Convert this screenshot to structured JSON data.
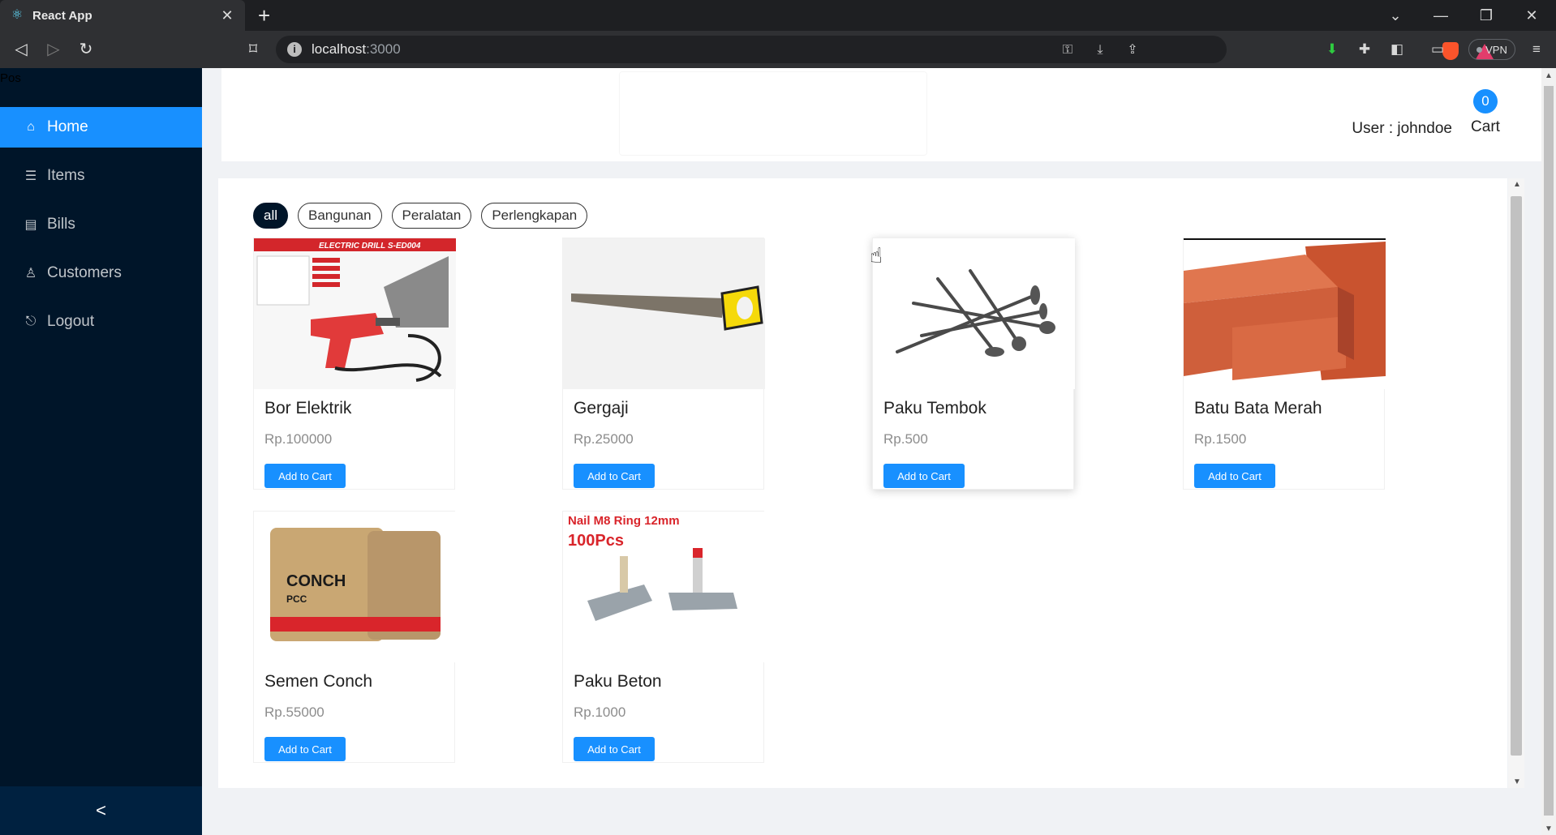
{
  "browser": {
    "tab_title": "React App",
    "tab_close": "✕",
    "new_tab": "+",
    "url_host": "localhost",
    "url_port": ":3000",
    "vpn_label": "VPN"
  },
  "sidebar": {
    "logo_text": "Pos",
    "items": [
      {
        "label": "Home",
        "icon": "home-icon",
        "glyph": "⌂"
      },
      {
        "label": "Items",
        "icon": "list-icon",
        "glyph": "☰"
      },
      {
        "label": "Bills",
        "icon": "receipt-icon",
        "glyph": "▤"
      },
      {
        "label": "Customers",
        "icon": "user-icon",
        "glyph": "♙"
      },
      {
        "label": "Logout",
        "icon": "logout-icon",
        "glyph": "⎋"
      }
    ],
    "active_item": "Home",
    "collapse_glyph": "<"
  },
  "header": {
    "user_label": "User : johndoe",
    "cart_count": "0",
    "cart_label": "Cart"
  },
  "filters": [
    "all",
    "Bangunan",
    "Peralatan",
    "Perlengkapan"
  ],
  "active_filter": "all",
  "products": [
    {
      "name": "Bor Elektrik",
      "price": "Rp.100000",
      "button": "Add to Cart",
      "image_caption": "ELECTRIC DRILL S-ED004"
    },
    {
      "name": "Gergaji",
      "price": "Rp.25000",
      "button": "Add to Cart"
    },
    {
      "name": "Paku Tembok",
      "price": "Rp.500",
      "button": "Add to Cart"
    },
    {
      "name": "Batu Bata Merah",
      "price": "Rp.1500",
      "button": "Add to Cart"
    },
    {
      "name": "Semen Conch",
      "price": "Rp.55000",
      "button": "Add to Cart",
      "image_caption": "CONCH"
    },
    {
      "name": "Paku Beton",
      "price": "Rp.1000",
      "button": "Add to Cart",
      "image_caption": "Nail M8 Ring 12mm",
      "image_caption2": "100Pcs"
    }
  ],
  "colors": {
    "sider": "#001529",
    "accent": "#1890ff"
  }
}
